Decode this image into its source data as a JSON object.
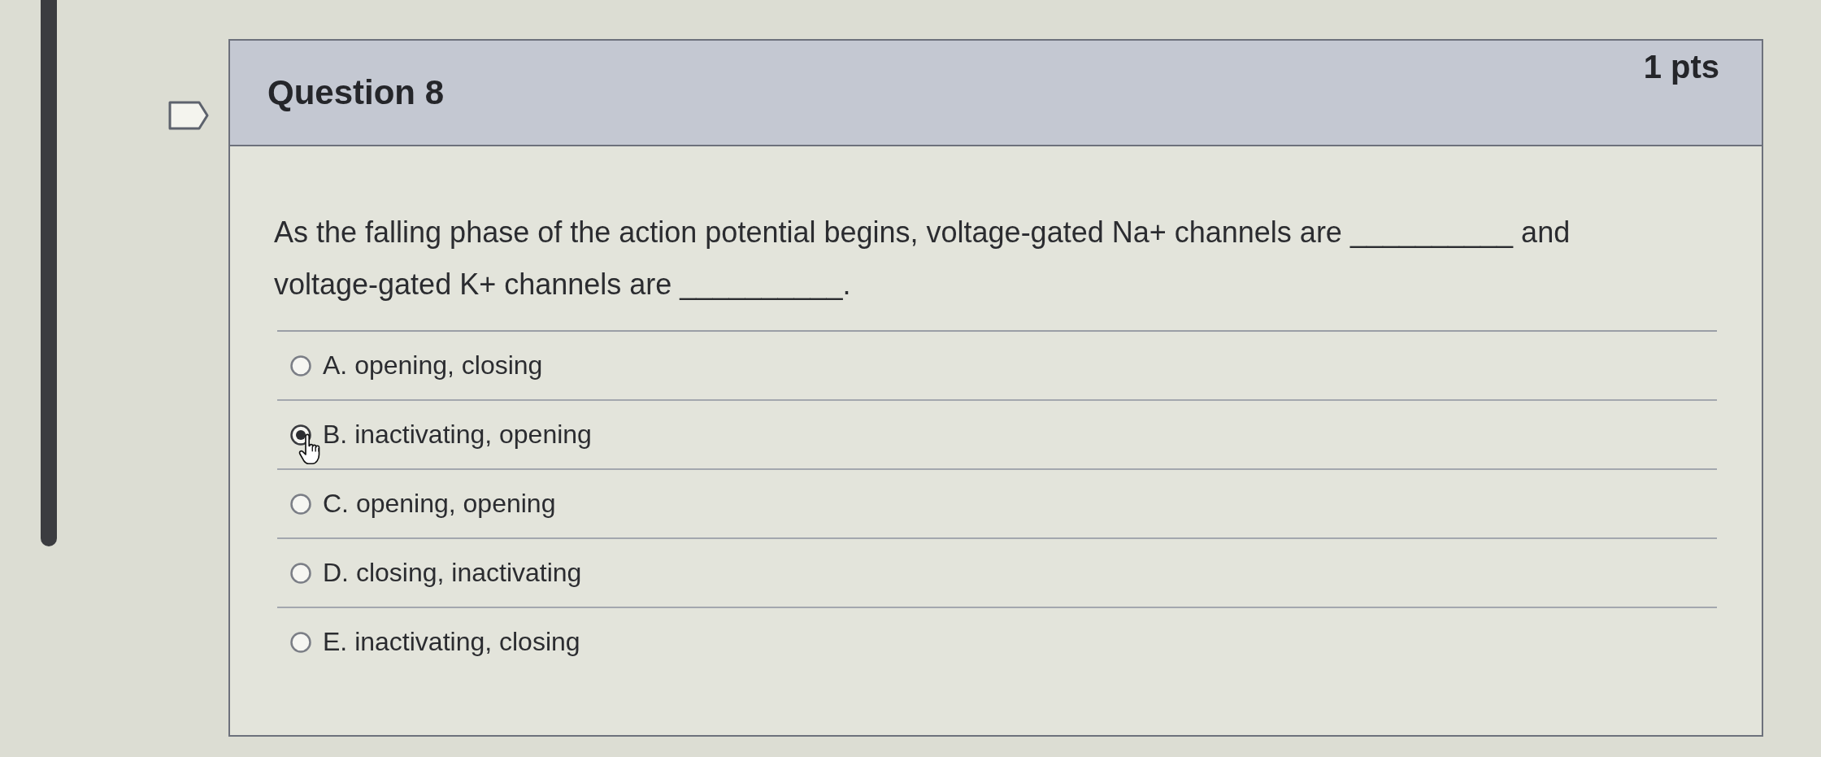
{
  "question": {
    "title": "Question 8",
    "points": "1 pts",
    "flagged": false,
    "text": "As the falling phase of the action potential begins, voltage-gated Na+ channels are __________ and voltage-gated K+ channels are __________."
  },
  "options": [
    {
      "label": "A. opening, closing",
      "selected": false
    },
    {
      "label": "B. inactivating, opening",
      "selected": true
    },
    {
      "label": "C. opening, opening",
      "selected": false
    },
    {
      "label": "D. closing, inactivating",
      "selected": false
    },
    {
      "label": "E. inactivating, closing",
      "selected": false
    }
  ]
}
